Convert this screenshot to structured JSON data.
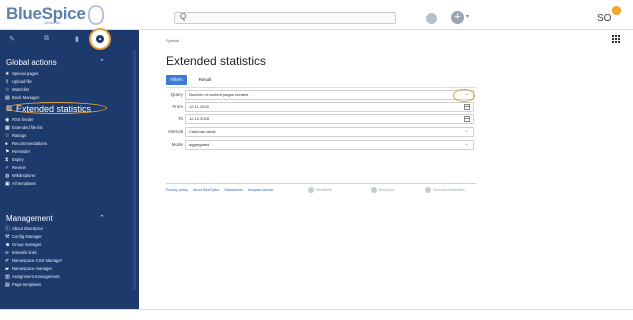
{
  "header": {
    "logo_text": "BlueSpice",
    "logo_sub": "MediaWiki",
    "search_placeholder": "Q",
    "user_initials": "SO"
  },
  "sidebar": {
    "section_global": "Global actions",
    "global_items": [
      {
        "label": "Special pages",
        "icon": "star-icon"
      },
      {
        "label": "Upload file",
        "icon": "upload-icon"
      },
      {
        "label": "Watchlist",
        "icon": "star-outline-icon"
      },
      {
        "label": "Book Manager",
        "icon": "book-icon"
      },
      {
        "label": "Extended statistics",
        "icon": "chart-icon"
      },
      {
        "label": "RSS feeder",
        "icon": "rss-icon"
      },
      {
        "label": "Extended file list",
        "icon": "file-list-icon"
      },
      {
        "label": "Ratings",
        "icon": "star-icon"
      },
      {
        "label": "Recommendations",
        "icon": "thumb-icon"
      },
      {
        "label": "Reminder",
        "icon": "flag-icon"
      },
      {
        "label": "Expiry",
        "icon": "hourglass-icon"
      },
      {
        "label": "Review",
        "icon": "check-icon"
      },
      {
        "label": "WikiExplorer",
        "icon": "globe-icon"
      },
      {
        "label": "All templates",
        "icon": "template-icon"
      }
    ],
    "section_management": "Management",
    "management_items": [
      {
        "label": "About BlueSpice",
        "icon": "info-icon"
      },
      {
        "label": "Config Manager",
        "icon": "wrench-icon"
      },
      {
        "label": "Group manager",
        "icon": "group-icon"
      },
      {
        "label": "Interwiki links",
        "icon": "link-icon"
      },
      {
        "label": "Namespace-CSS Manager",
        "icon": "brush-icon"
      },
      {
        "label": "Namespace manager",
        "icon": "folder-icon"
      },
      {
        "label": "Assignment management",
        "icon": "assign-icon"
      },
      {
        "label": "Page templates",
        "icon": "page-icon"
      }
    ]
  },
  "content": {
    "breadcrumb": "Special",
    "title": "Extended statistics",
    "tabs": [
      "Filters",
      "Result"
    ],
    "form": {
      "query_label": "Query",
      "query_value": "Number of content pages created",
      "from_label": "From",
      "from_value": "12.11.2018",
      "to_label": "To",
      "to_value": "12.12.2018",
      "interval_label": "Interval",
      "interval_value": "Calendar week",
      "mode_label": "Mode",
      "mode_value": "aggregated"
    }
  },
  "footer": {
    "links": [
      "Privacy policy",
      "About BlueSpice",
      "Disclaimers",
      "Analysis service"
    ],
    "badges": [
      "MediaWiki",
      "BlueSpice",
      "Semantic MediaWiki"
    ]
  }
}
